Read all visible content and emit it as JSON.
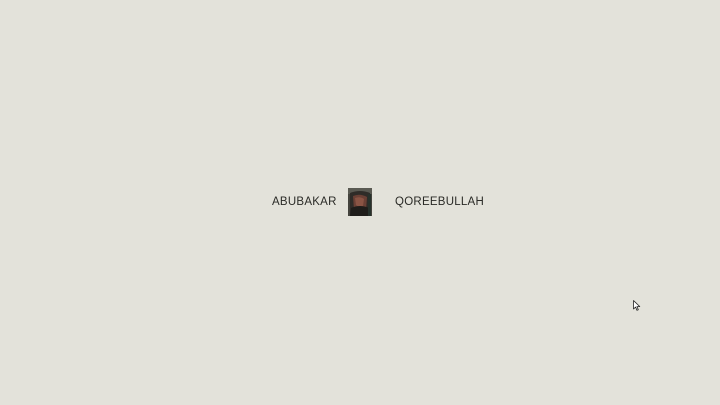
{
  "intro": {
    "first_name": "ABUBAKAR",
    "last_name": "QOREEBULLAH",
    "portrait_icon": "portrait-photo"
  },
  "pointer": {
    "icon": "cursor-arrow-icon"
  },
  "colors": {
    "background": "#e3e2da",
    "text": "#2a2a26"
  }
}
